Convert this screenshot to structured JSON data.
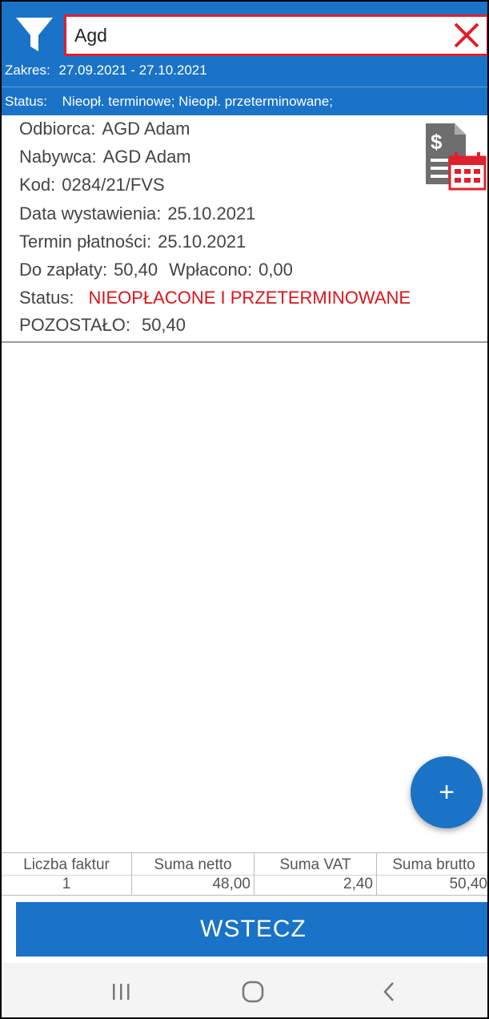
{
  "search": {
    "value": "Agd"
  },
  "header": {
    "range_label": "Zakres:",
    "range_value": "27.09.2021 - 27.10.2021",
    "status_label": "Status:",
    "status_value": "Nieopł. terminowe; Nieopł. przeterminowane;"
  },
  "invoice": {
    "recipient_label": "Odbiorca:",
    "recipient": "AGD Adam",
    "buyer_label": "Nabywca:",
    "buyer": "AGD Adam",
    "code_label": "Kod:",
    "code": "0284/21/FVS",
    "issue_date_label": "Data wystawienia:",
    "issue_date": "25.10.2021",
    "due_date_label": "Termin płatności:",
    "due_date": "25.10.2021",
    "to_pay_label": "Do zapłaty:",
    "to_pay": "50,40",
    "paid_label": "Wpłacono:",
    "paid": "0,00",
    "status_label": "Status:",
    "status": "NIEOPŁACONE I PRZETERMINOWANE",
    "remaining_label": "POZOSTAŁO:",
    "remaining": "50,40"
  },
  "fab": {
    "label": "+"
  },
  "summary": {
    "columns": [
      {
        "header": "Liczba faktur",
        "value": "1"
      },
      {
        "header": "Suma netto",
        "value": "48,00"
      },
      {
        "header": "Suma VAT",
        "value": "2,40"
      },
      {
        "header": "Suma brutto",
        "value": "50,40"
      }
    ]
  },
  "back_button": {
    "label": "WSTECZ"
  },
  "navbar": {
    "icons": [
      "recent-apps-icon",
      "home-icon",
      "back-icon"
    ]
  },
  "colors": {
    "accent": "#1a73c6",
    "alert": "#d9151b",
    "search_border": "#e0202a"
  }
}
